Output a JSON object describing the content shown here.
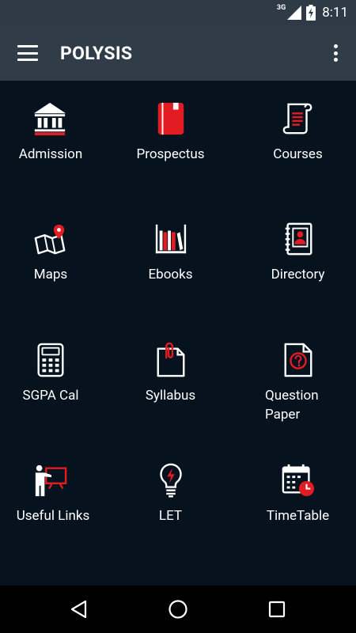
{
  "status_bar": {
    "network": "3G",
    "time": "8:11"
  },
  "app_bar": {
    "title": "POLYSIS"
  },
  "colors": {
    "accent": "#e31b23",
    "background": "#06131e",
    "appbar": "#303d48",
    "statusbar": "#2e3a45"
  },
  "tiles": [
    {
      "label": "Admission",
      "icon": "bank-icon"
    },
    {
      "label": "Prospectus",
      "icon": "notebook-icon"
    },
    {
      "label": "Courses",
      "icon": "scroll-icon"
    },
    {
      "label": "Maps",
      "icon": "map-icon"
    },
    {
      "label": "Ebooks",
      "icon": "bookshelf-icon"
    },
    {
      "label": "Directory",
      "icon": "contacts-book-icon"
    },
    {
      "label": "SGPA Cal",
      "icon": "calculator-icon"
    },
    {
      "label": "Syllabus",
      "icon": "clipped-page-icon"
    },
    {
      "label": "Question Paper",
      "icon": "question-document-icon"
    },
    {
      "label": "Useful Links",
      "icon": "presentation-icon"
    },
    {
      "label": "LET",
      "icon": "lightbulb-icon"
    },
    {
      "label": "TimeTable",
      "icon": "calendar-clock-icon"
    }
  ]
}
